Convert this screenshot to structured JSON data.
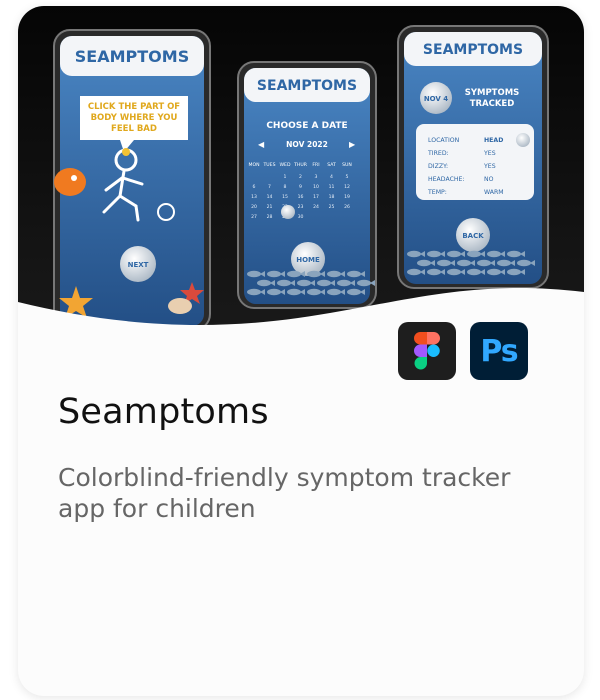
{
  "project": {
    "title": "Seamptoms",
    "description": "Colorblind-friendly symptom tracker app for children",
    "tools": [
      {
        "name": "figma-icon",
        "color": "#1e1e1e"
      },
      {
        "name": "Ps",
        "color": "#001e36"
      }
    ]
  },
  "screens": {
    "app_name": "SEAMPTOMS",
    "screen1": {
      "prompt_line1": "CLICK THE PART OF",
      "prompt_line2": "BODY WHERE YOU",
      "prompt_line3": "FEEL BAD",
      "next_button": "NEXT"
    },
    "screen2": {
      "heading": "CHOOSE A DATE",
      "month": "NOV 2022",
      "weekdays": [
        "MON",
        "TUES",
        "WED",
        "THUR",
        "FRI",
        "SAT",
        "SUN"
      ],
      "home_button": "HOME"
    },
    "screen3": {
      "date_badge": "NOV 4",
      "heading_line1": "SYMPTOMS",
      "heading_line2": "TRACKED",
      "rows": [
        {
          "label": "LOCATION",
          "value": "HEAD"
        },
        {
          "label": "TIRED:",
          "value": "YES"
        },
        {
          "label": "DIZZY:",
          "value": "YES"
        },
        {
          "label": "HEADACHE:",
          "value": "NO"
        },
        {
          "label": "TEMP:",
          "value": "WARM"
        }
      ],
      "back_button": "BACK"
    }
  },
  "colors": {
    "accent_yellow": "#f2c233",
    "screen_blue": "#3a6fa8",
    "ps_blue": "#31a8ff"
  }
}
